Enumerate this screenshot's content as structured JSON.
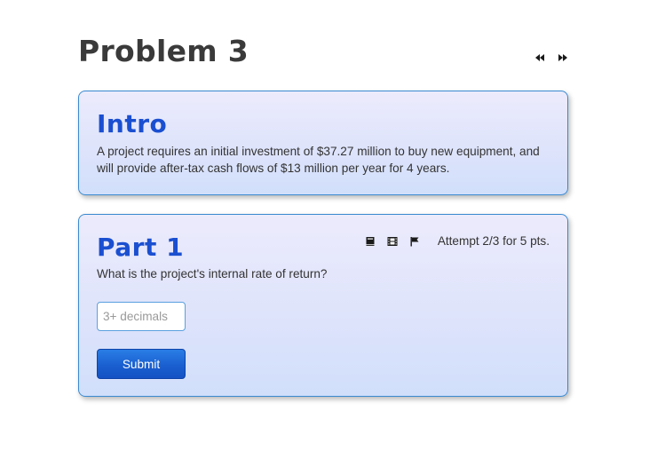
{
  "page": {
    "title": "Problem 3"
  },
  "nav": {
    "prev_icon": "rewind-icon",
    "next_icon": "fast-forward-icon"
  },
  "intro": {
    "heading": "Intro",
    "text": "A project requires an initial investment of $37.27 million to buy new equipment, and will provide after-tax cash flows of $13 million per year for 4 years."
  },
  "part1": {
    "heading": "Part 1",
    "question": "What is the project's internal rate of return?",
    "tool_icons": [
      "book-icon",
      "film-icon",
      "flag-icon"
    ],
    "attempt": "Attempt 2/3 for 5 pts.",
    "answer": {
      "value": "",
      "placeholder": "3+ decimals"
    },
    "submit_label": "Submit"
  },
  "colors": {
    "heading_blue": "#1a4fd0",
    "card_border": "#3a8ad0",
    "button_blue": "#1a5fd0"
  }
}
